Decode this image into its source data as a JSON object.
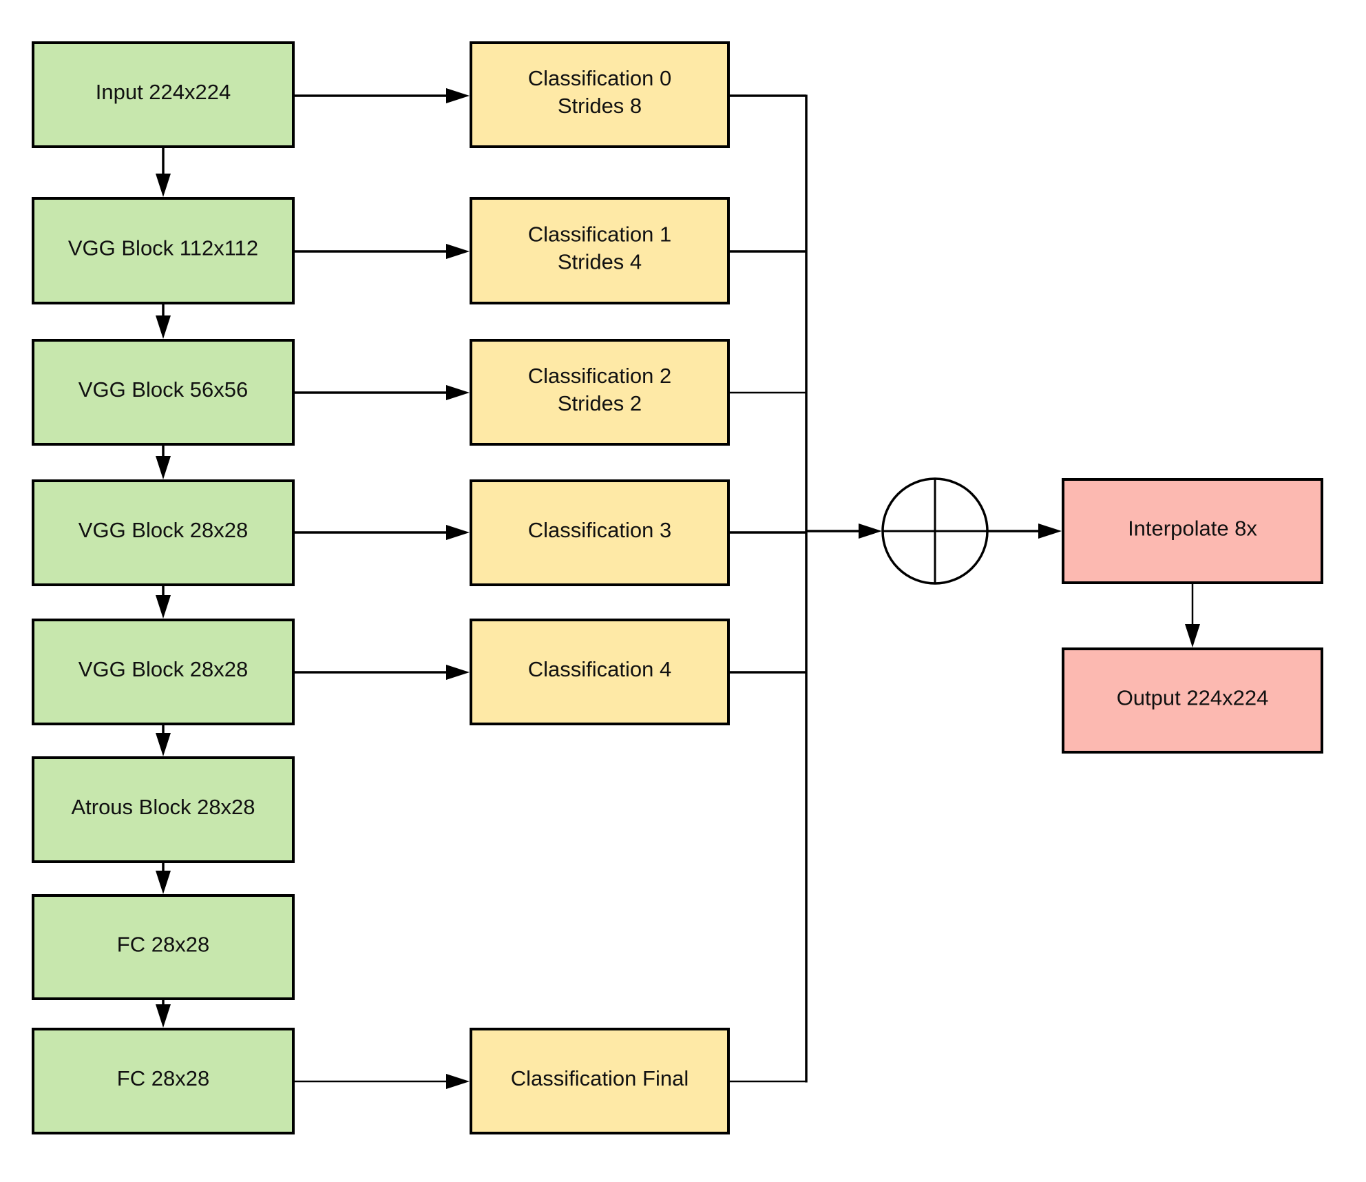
{
  "diagram": {
    "colors": {
      "backbone": "#c7e7ad",
      "classifier": "#fee9a6",
      "output": "#fcb9b1",
      "stroke": "#000000",
      "background": "#ffffff"
    },
    "nodes": [
      {
        "id": "input",
        "group": "backbone",
        "lines": [
          "Input 224x224"
        ]
      },
      {
        "id": "vgg112",
        "group": "backbone",
        "lines": [
          "VGG Block 112x112"
        ]
      },
      {
        "id": "vgg56",
        "group": "backbone",
        "lines": [
          "VGG Block 56x56"
        ]
      },
      {
        "id": "vgg28a",
        "group": "backbone",
        "lines": [
          "VGG Block 28x28"
        ]
      },
      {
        "id": "vgg28b",
        "group": "backbone",
        "lines": [
          "VGG Block 28x28"
        ]
      },
      {
        "id": "atrous",
        "group": "backbone",
        "lines": [
          "Atrous Block 28x28"
        ]
      },
      {
        "id": "fc1",
        "group": "backbone",
        "lines": [
          "FC 28x28"
        ]
      },
      {
        "id": "fc2",
        "group": "backbone",
        "lines": [
          "FC 28x28"
        ]
      },
      {
        "id": "cls0",
        "group": "classifier",
        "lines": [
          "Classification 0",
          "Strides 8"
        ]
      },
      {
        "id": "cls1",
        "group": "classifier",
        "lines": [
          "Classification 1",
          "Strides 4"
        ]
      },
      {
        "id": "cls2",
        "group": "classifier",
        "lines": [
          "Classification 2",
          "Strides 2"
        ]
      },
      {
        "id": "cls3",
        "group": "classifier",
        "lines": [
          "Classification 3"
        ]
      },
      {
        "id": "cls4",
        "group": "classifier",
        "lines": [
          "Classification 4"
        ]
      },
      {
        "id": "clsf",
        "group": "classifier",
        "lines": [
          "Classification Final"
        ]
      },
      {
        "id": "sum",
        "group": "operator",
        "symbol": "circle-plus",
        "lines": []
      },
      {
        "id": "interp",
        "group": "output",
        "lines": [
          "Interpolate 8x"
        ]
      },
      {
        "id": "out",
        "group": "output",
        "lines": [
          "Output 224x224"
        ]
      }
    ],
    "edges": [
      {
        "from": "input",
        "to": "vgg112",
        "type": "arrow"
      },
      {
        "from": "vgg112",
        "to": "vgg56",
        "type": "arrow"
      },
      {
        "from": "vgg56",
        "to": "vgg28a",
        "type": "arrow"
      },
      {
        "from": "vgg28a",
        "to": "vgg28b",
        "type": "arrow"
      },
      {
        "from": "vgg28b",
        "to": "atrous",
        "type": "arrow"
      },
      {
        "from": "atrous",
        "to": "fc1",
        "type": "arrow"
      },
      {
        "from": "fc1",
        "to": "fc2",
        "type": "arrow"
      },
      {
        "from": "input",
        "to": "cls0",
        "type": "arrow"
      },
      {
        "from": "vgg112",
        "to": "cls1",
        "type": "arrow"
      },
      {
        "from": "vgg56",
        "to": "cls2",
        "type": "arrow"
      },
      {
        "from": "vgg28a",
        "to": "cls3",
        "type": "arrow"
      },
      {
        "from": "vgg28b",
        "to": "cls4",
        "type": "arrow"
      },
      {
        "from": "fc2",
        "to": "clsf",
        "type": "arrow"
      },
      {
        "from": "cls0",
        "to": "sum",
        "type": "bus"
      },
      {
        "from": "cls1",
        "to": "sum",
        "type": "bus"
      },
      {
        "from": "cls2",
        "to": "sum",
        "type": "bus"
      },
      {
        "from": "cls3",
        "to": "sum",
        "type": "bus"
      },
      {
        "from": "cls4",
        "to": "sum",
        "type": "bus"
      },
      {
        "from": "clsf",
        "to": "sum",
        "type": "bus"
      },
      {
        "from": "sum",
        "to": "interp",
        "type": "arrow"
      },
      {
        "from": "interp",
        "to": "out",
        "type": "arrow"
      }
    ]
  }
}
